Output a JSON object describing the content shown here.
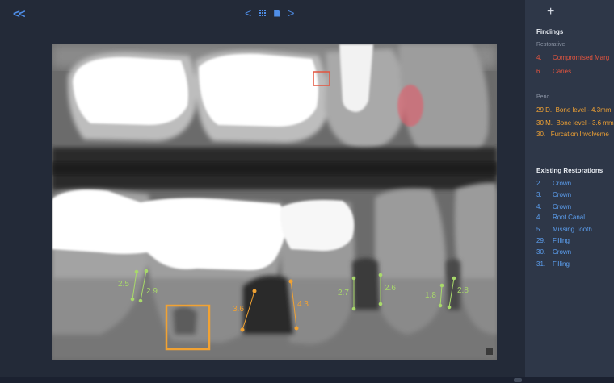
{
  "nav": {
    "collapse": "<<",
    "prev": "<",
    "next": ">"
  },
  "panel": {
    "add": "+",
    "findings_title": "Findings",
    "restorative_label": "Restorative",
    "restorative_items": [
      {
        "num": "4.",
        "text": "Compromised Marg"
      },
      {
        "num": "6.",
        "text": "Caries"
      }
    ],
    "perio_label": "Perio",
    "perio_items": [
      {
        "num": "29 D.",
        "text": "Bone level - 4.3mm"
      },
      {
        "num": "30 M.",
        "text": "Bone level - 3.6 mm"
      },
      {
        "num": "30.",
        "text": "Furcation Involveme"
      }
    ],
    "existing_title": "Existing Restorations",
    "existing_items": [
      {
        "num": "2.",
        "text": "Crown"
      },
      {
        "num": "3.",
        "text": "Crown"
      },
      {
        "num": "4.",
        "text": "Crown"
      },
      {
        "num": "4.",
        "text": "Root Canal"
      },
      {
        "num": "5.",
        "text": "Missing Tooth"
      },
      {
        "num": "29.",
        "text": "Filling"
      },
      {
        "num": "30.",
        "text": "Crown"
      },
      {
        "num": "31.",
        "text": "Filling"
      }
    ]
  },
  "measurements": {
    "green": [
      "2.5",
      "2.9",
      "2.7",
      "2.6",
      "1.8",
      "2.8"
    ],
    "orange": [
      "3.6",
      "4.3"
    ]
  },
  "colors": {
    "accent": "#4f8ee8",
    "finding_red": "#e4553f",
    "perio_orange": "#f1a233",
    "measure_green": "#a8d96a"
  }
}
